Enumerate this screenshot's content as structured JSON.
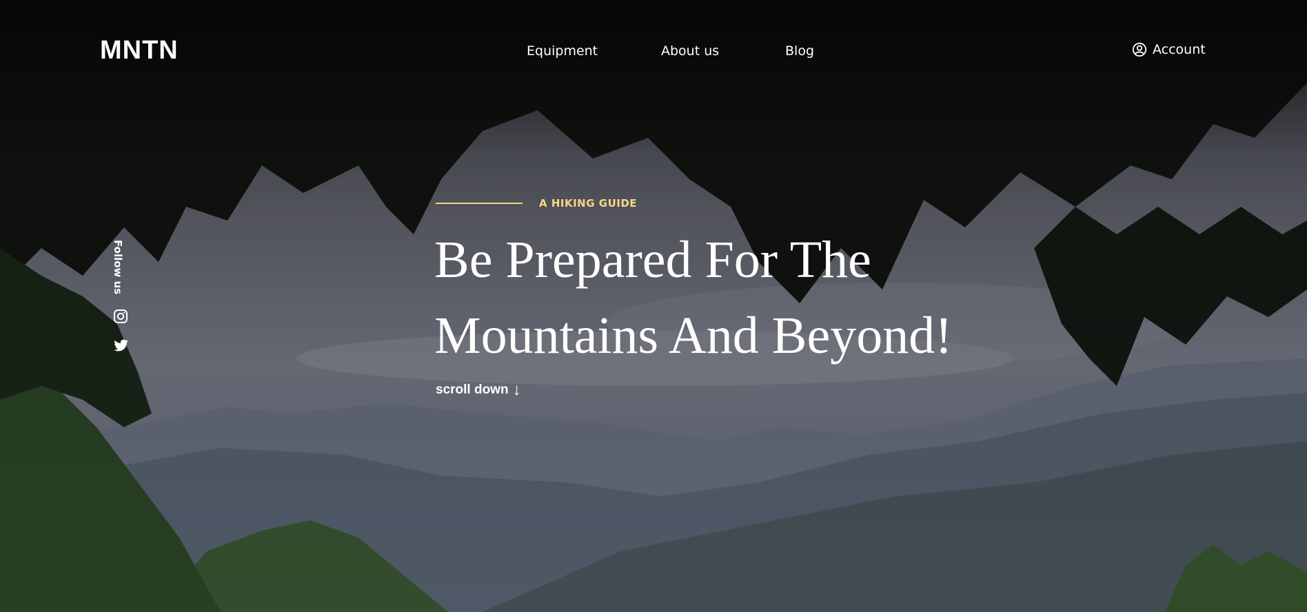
{
  "brand": {
    "logo_text": "MNTN"
  },
  "nav": {
    "items": [
      {
        "label": "Equipment"
      },
      {
        "label": "About us"
      },
      {
        "label": "Blog"
      }
    ],
    "account_label": "Account",
    "account_icon": "user-circle-icon"
  },
  "social": {
    "label": "Follow us",
    "items": [
      {
        "icon": "instagram-icon"
      },
      {
        "icon": "twitter-icon"
      }
    ]
  },
  "hero": {
    "eyebrow": "A HIKING GUIDE",
    "headline_line1": "Be Prepared For The",
    "headline_line2": "Mountains And Beyond!",
    "scroll_label": "scroll down",
    "scroll_icon": "arrow-down-icon"
  },
  "colors": {
    "accent": "#fbd784",
    "text": "#ffffff"
  }
}
